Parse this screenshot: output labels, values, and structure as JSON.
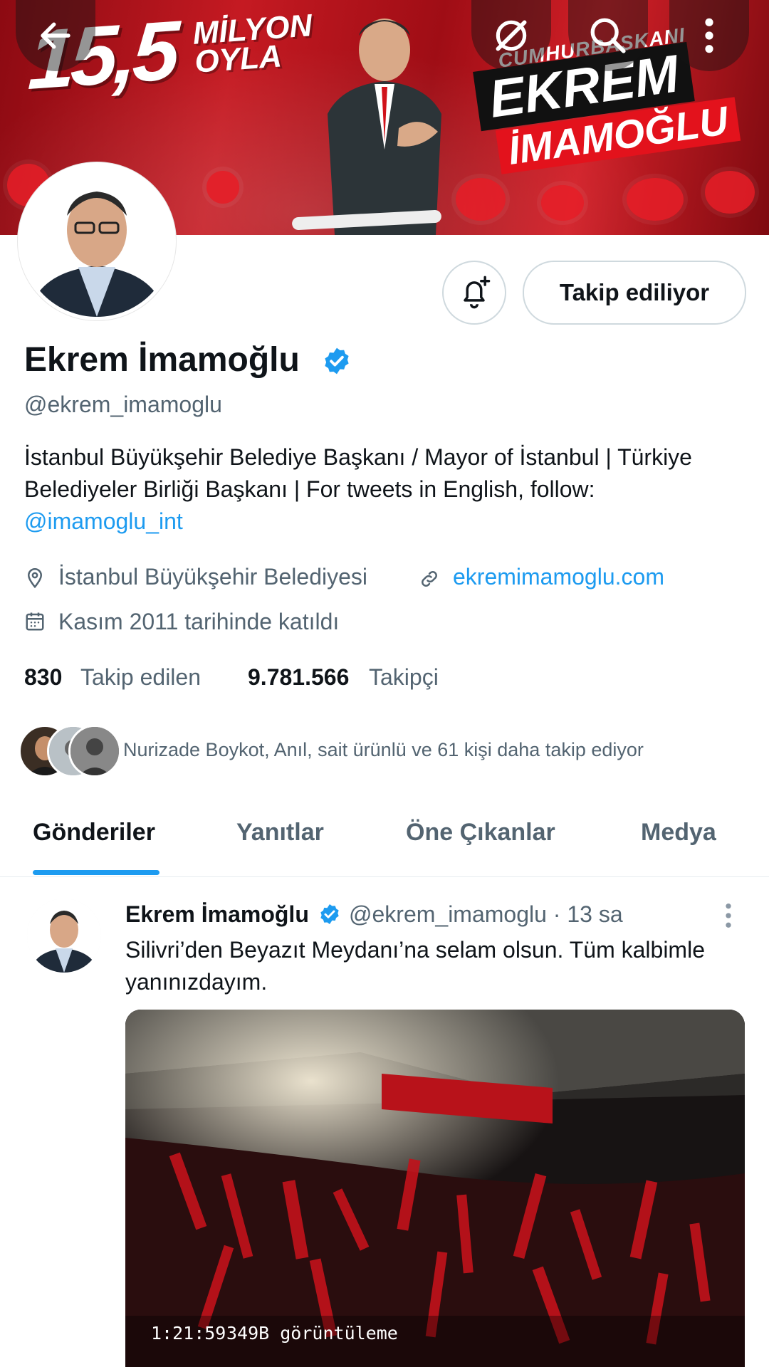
{
  "banner": {
    "big_number": "15,5",
    "big_text": "MİLYON\nOYLA",
    "subtitle": "CUMHURBAŞKANI ADAYI",
    "name_line1": "EKREM",
    "name_line2": "İMAMOĞLU"
  },
  "top_bar": {
    "back_icon": "arrow-left-icon",
    "grok_icon": "grok-icon",
    "search_icon": "search-icon",
    "more_icon": "more-vertical-icon"
  },
  "profile": {
    "display_name": "Ekrem İmamoğlu",
    "handle": "@ekrem_imamoglu",
    "following_button": "Takip ediliyor",
    "bio_text": "İstanbul Büyükşehir Belediye Başkanı / Mayor of İstanbul | Türkiye Belediyeler Birliği Başkanı | For tweets in English, follow: ",
    "bio_link": "@imamoglu_int",
    "location": "İstanbul Büyükşehir Belediyesi",
    "website": "ekremimamoglu.com",
    "joined": "Kasım 2011 tarihinde katıldı",
    "following_count": "830",
    "following_label": "Takip edilen",
    "followers_count": "9.781.566",
    "followers_label": "Takipçi",
    "followed_by": "Nurizade Boykot, Anıl, sait ürünlü ve 61 kişi daha takip ediyor"
  },
  "tabs": [
    "Gönderiler",
    "Yanıtlar",
    "Öne Çıkanlar",
    "Medya"
  ],
  "tweet": {
    "name": "Ekrem İmamoğlu",
    "handle_time": "@ekrem_imamoglu · 13 sa",
    "text": "Silivri’den Beyazıt Meydanı’na selam olsun. Tüm kalbimle yanınızdayım.",
    "video_duration": "1:21:59",
    "video_views": "349B görüntüleme"
  },
  "colors": {
    "accent": "#1d9bf0",
    "text": "#0f1419",
    "muted": "#536471",
    "banner_red": "#c51a22"
  }
}
